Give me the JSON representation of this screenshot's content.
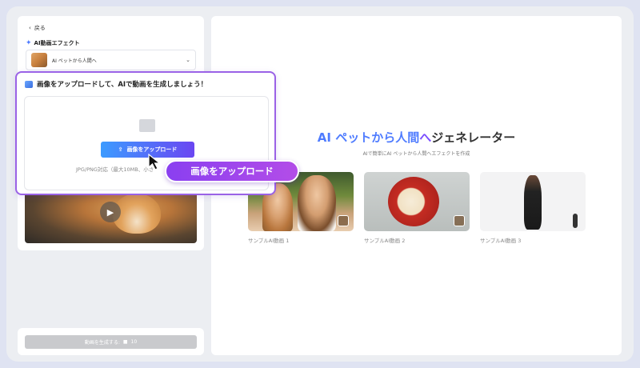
{
  "sidebar": {
    "back_label": "戻る",
    "effect_section_title": "AI動画エフェクト",
    "effect_select_value": "AI ペットから人間へ",
    "generate_button_label": "動画を生成する:",
    "generate_cost": "10"
  },
  "upload": {
    "title": "画像をアップロードして、AIで動画を生成しましょう！",
    "button_label": "画像をアップロード",
    "hint": "JPG/PNG対応（最大10MB、小さ"
  },
  "callout_label": "画像をアップロード",
  "main": {
    "title_prefix": "AI",
    "title_accent": "ペットから人間",
    "title_particle": "へ",
    "title_suffix": "ジェネレーター",
    "subtitle": "AIで簡単にAI ペットから人間へエフェクトを作成",
    "samples": [
      {
        "caption": "サンプルAI動画 1"
      },
      {
        "caption": "サンプルAI動画 2"
      },
      {
        "caption": "サンプルAI動画 3"
      }
    ]
  },
  "colors": {
    "accent_blue": "#4f7cff",
    "accent_purple": "#9a62e6",
    "callout": "#a145ec"
  }
}
